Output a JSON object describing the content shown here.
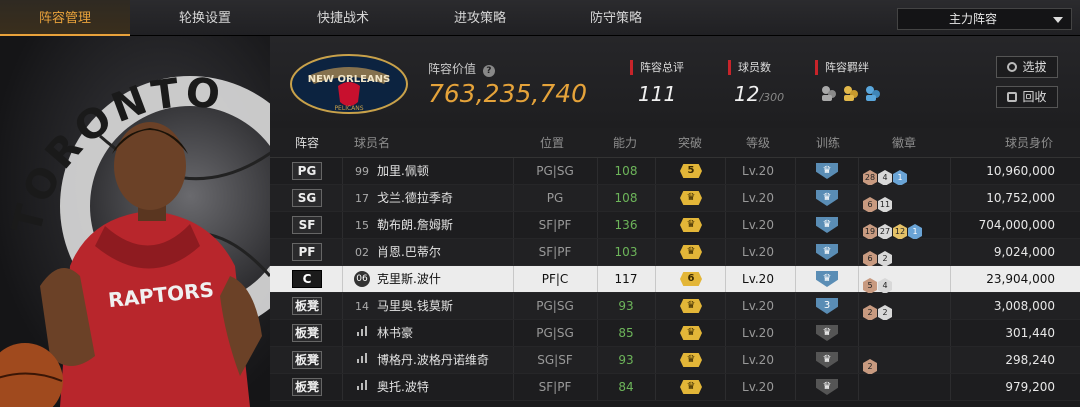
{
  "tabs": [
    "阵容管理",
    "轮换设置",
    "快捷战术",
    "进攻策略",
    "防守策略"
  ],
  "dropdown": {
    "selected": "主力阵容"
  },
  "team": {
    "logo_text_top": "NEW ORLEANS",
    "logo_text_bottom": "PELICANS",
    "value_label": "阵容价值",
    "value": "763,235,740",
    "rating_label": "阵容总评",
    "rating": "111",
    "players_label": "球员数",
    "players": "12",
    "players_max": "/300",
    "bond_label": "阵容羁绊"
  },
  "buttons": {
    "select": "选拔",
    "recycle": "回收"
  },
  "player_art": {
    "team_text": "TORONTO",
    "jersey": "RAPTORS"
  },
  "headers": {
    "lineup": "阵容",
    "name": "球员名",
    "position": "位置",
    "ability": "能力",
    "breakthrough": "突破",
    "level": "等级",
    "training": "训练",
    "badges": "徽章",
    "value": "球员身价"
  },
  "rows": [
    {
      "slot": "PG",
      "num": "99",
      "name": "加里.佩顿",
      "pos": "PG|SG",
      "ability": "108",
      "brk": "5",
      "level": "Lv.20",
      "train": "",
      "badges": [
        {
          "t": "b-bronze",
          "v": "28"
        },
        {
          "t": "b-silver",
          "v": "4"
        },
        {
          "t": "b-blue",
          "v": "1"
        }
      ],
      "value": "10,960,000"
    },
    {
      "slot": "SG",
      "num": "17",
      "name": "戈兰.德拉季奇",
      "pos": "PG",
      "ability": "108",
      "brk": "",
      "level": "Lv.20",
      "train": "",
      "badges": [
        {
          "t": "b-bronze",
          "v": "6"
        },
        {
          "t": "b-silver",
          "v": "11"
        }
      ],
      "value": "10,752,000"
    },
    {
      "slot": "SF",
      "num": "15",
      "name": "勒布朗.詹姆斯",
      "pos": "SF|PF",
      "ability": "136",
      "brk": "",
      "level": "Lv.20",
      "train": "",
      "badges": [
        {
          "t": "b-bronze",
          "v": "19"
        },
        {
          "t": "b-silver",
          "v": "27"
        },
        {
          "t": "b-gold",
          "v": "12"
        },
        {
          "t": "b-blue",
          "v": "1"
        }
      ],
      "value": "704,000,000"
    },
    {
      "slot": "PF",
      "num": "02",
      "name": "肖恩.巴蒂尔",
      "pos": "SF|PF",
      "ability": "103",
      "brk": "",
      "level": "Lv.20",
      "train": "",
      "badges": [
        {
          "t": "b-bronze",
          "v": "6"
        },
        {
          "t": "b-silver",
          "v": "2"
        }
      ],
      "value": "9,024,000"
    },
    {
      "slot": "C",
      "num": "06",
      "name": "克里斯.波什",
      "pos": "PF|C",
      "ability": "117",
      "brk": "6",
      "level": "Lv.20",
      "train": "",
      "badges": [
        {
          "t": "b-bronze",
          "v": "5"
        },
        {
          "t": "b-silver",
          "v": "4"
        }
      ],
      "value": "23,904,000"
    },
    {
      "slot": "板凳",
      "num": "14",
      "name": "马里奥.钱莫斯",
      "pos": "PG|SG",
      "ability": "93",
      "brk": "",
      "level": "Lv.20",
      "train": "3",
      "badges": [
        {
          "t": "b-bronze",
          "v": "2"
        },
        {
          "t": "b-silver",
          "v": "2"
        }
      ],
      "value": "3,008,000"
    },
    {
      "slot": "板凳",
      "num": "",
      "name": "林书豪",
      "pos": "PG|SG",
      "ability": "85",
      "brk": "",
      "level": "Lv.20",
      "train": "",
      "badges": [],
      "value": "301,440"
    },
    {
      "slot": "板凳",
      "num": "",
      "name": "博格丹.波格丹诺维奇",
      "pos": "SG|SF",
      "ability": "93",
      "brk": "",
      "level": "Lv.20",
      "train": "",
      "badges": [
        {
          "t": "b-bronze",
          "v": "2"
        }
      ],
      "value": "298,240"
    },
    {
      "slot": "板凳",
      "num": "",
      "name": "奥托.波特",
      "pos": "SF|PF",
      "ability": "84",
      "brk": "",
      "level": "Lv.20",
      "train": "",
      "badges": [],
      "value": "979,200"
    }
  ],
  "colors": {
    "accent": "#e9a23b",
    "positive": "#6db55a",
    "red_marker": "#c8242a"
  }
}
